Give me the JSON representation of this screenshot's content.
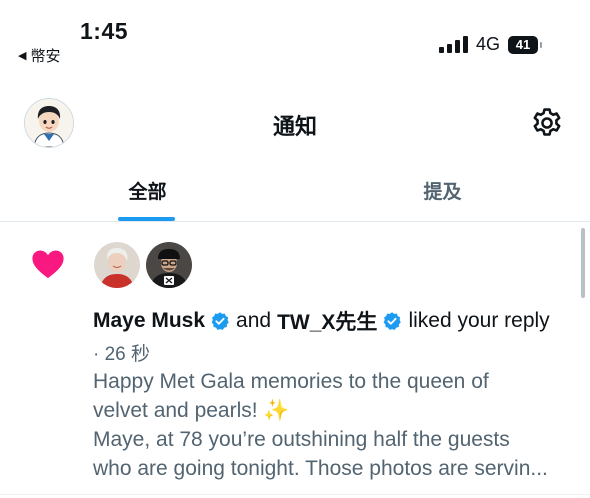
{
  "status_bar": {
    "time": "1:45",
    "back_arrow": "◀",
    "back_label": "幣安",
    "network": "4G",
    "battery": "41"
  },
  "header": {
    "title": "通知",
    "avatar_icon": "profile-avatar-icon",
    "settings_icon": "gear-icon"
  },
  "tabs": [
    {
      "label": "全部",
      "active": true
    },
    {
      "label": "提及",
      "active": false
    }
  ],
  "notification": {
    "type_icon": "heart-icon",
    "type_color": "#f91880",
    "user1": "Maye Musk",
    "connector": "and",
    "user2": "TW_X先生",
    "action": "liked your reply",
    "time": "· 26 秒",
    "lines": [
      "Happy Met Gala memories to the queen of",
      "velvet and pearls! ✨",
      "Maye, at 78 you’re outshining half the guests",
      "who are going tonight. Those photos are servin..."
    ]
  },
  "colors": {
    "accent": "#1d9bf0",
    "secondary_text": "#536471",
    "heart": "#f91880",
    "sparkle": "#f6c343"
  }
}
